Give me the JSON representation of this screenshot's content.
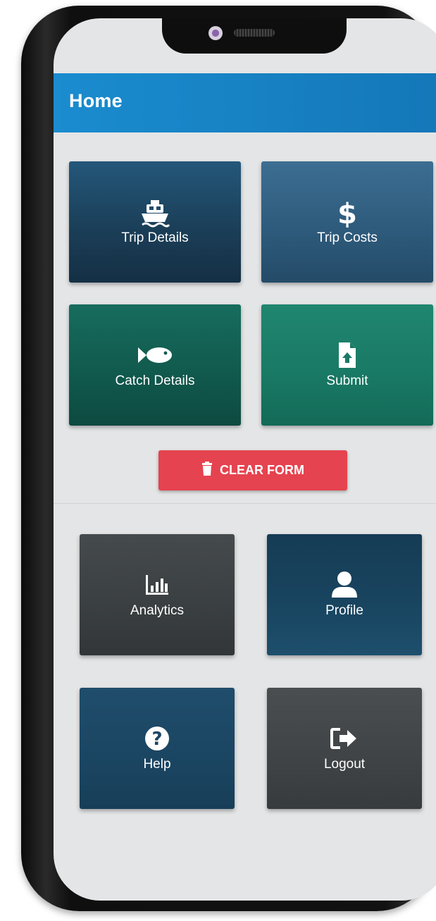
{
  "app_bar": {
    "title": "Home"
  },
  "tiles": [
    {
      "label": "Trip Details",
      "icon": "ship-icon"
    },
    {
      "label": "Trip Costs",
      "icon": "dollar-icon"
    },
    {
      "label": "Catch Details",
      "icon": "fish-icon"
    },
    {
      "label": "Submit",
      "icon": "file-upload-icon"
    }
  ],
  "clear_button": {
    "label": "CLEAR FORM",
    "icon": "trash-icon"
  },
  "menu_tiles": [
    {
      "label": "Analytics",
      "icon": "bar-chart-icon"
    },
    {
      "label": "Profile",
      "icon": "user-icon"
    },
    {
      "label": "Help",
      "icon": "question-icon"
    },
    {
      "label": "Logout",
      "icon": "sign-out-icon"
    }
  ],
  "colors": {
    "app_bar": "#1a8ccf",
    "dark_blue": "#1d4a66",
    "teal": "#127060",
    "gray": "#3f4345",
    "clear_red": "#e5434f",
    "screen_bg": "#e4e5e6"
  }
}
